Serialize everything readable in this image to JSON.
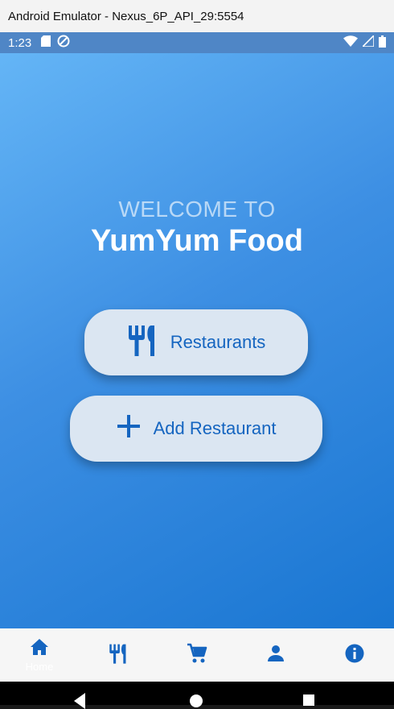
{
  "window": {
    "title": "Android Emulator - Nexus_6P_API_29:5554"
  },
  "status_bar": {
    "time": "1:23"
  },
  "hero": {
    "welcome": "WELCOME TO",
    "brand": "YumYum Food"
  },
  "buttons": {
    "restaurants": "Restaurants",
    "add_restaurant": "Add Restaurant"
  },
  "nav": {
    "items": [
      {
        "label": "Home",
        "icon": "home-icon",
        "active": true
      },
      {
        "label": "",
        "icon": "restaurant-icon"
      },
      {
        "label": "",
        "icon": "cart-icon"
      },
      {
        "label": "",
        "icon": "person-icon"
      },
      {
        "label": "",
        "icon": "info-icon"
      }
    ]
  },
  "colors": {
    "primary": "#1565c0",
    "gradient_start": "#64b5f6",
    "gradient_end": "#1976d2",
    "button_bg": "#dbe6f2"
  }
}
